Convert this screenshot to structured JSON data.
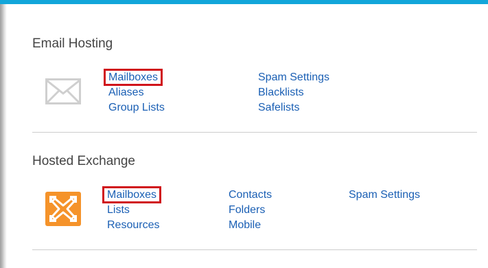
{
  "sections": {
    "email_hosting": {
      "title": "Email Hosting",
      "icon": "envelope-icon",
      "links": {
        "mailboxes": "Mailboxes",
        "aliases": "Aliases",
        "group_lists": "Group Lists",
        "spam_settings": "Spam Settings",
        "blacklists": "Blacklists",
        "safelists": "Safelists"
      }
    },
    "hosted_exchange": {
      "title": "Hosted Exchange",
      "icon": "exchange-logo-icon",
      "links": {
        "mailboxes": "Mailboxes",
        "lists": "Lists",
        "resources": "Resources",
        "contacts": "Contacts",
        "folders": "Folders",
        "mobile": "Mobile",
        "spam_settings": "Spam Settings"
      }
    }
  },
  "colors": {
    "accent_bar": "#12a6da",
    "link": "#1a5fb4",
    "highlight_box": "#d0141b",
    "exchange_icon": "#f5932a"
  }
}
